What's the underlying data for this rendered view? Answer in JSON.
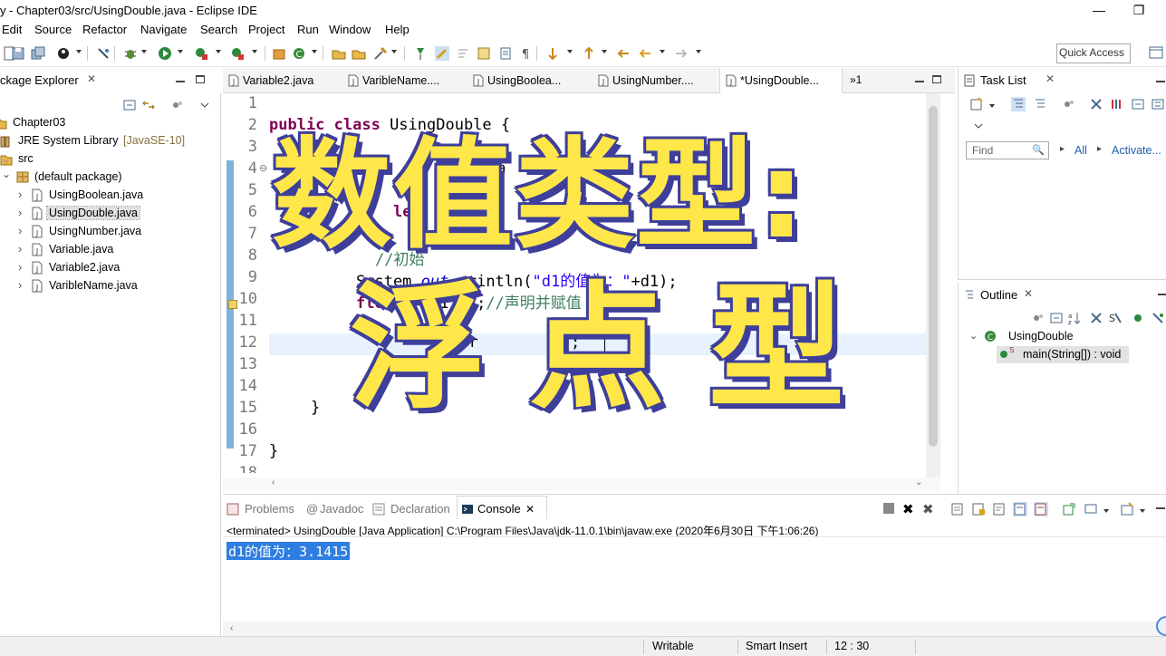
{
  "window": {
    "title": "y - Chapter03/src/UsingDouble.java - Eclipse IDE"
  },
  "menu": [
    "Edit",
    "Source",
    "Refactor",
    "Navigate",
    "Search",
    "Project",
    "Run",
    "Window",
    "Help"
  ],
  "toolbar": {
    "quick_access": "Quick Access"
  },
  "package_explorer": {
    "title": "ckage Explorer",
    "tree": [
      {
        "label": "Chapter03",
        "detail": "",
        "indent": 0,
        "arrow": "",
        "icon": "project-icon"
      },
      {
        "label": "JRE System Library",
        "detail": "[JavaSE-10]",
        "indent": 0,
        "arrow": "",
        "icon": "library-icon"
      },
      {
        "label": "src",
        "detail": "",
        "indent": 0,
        "arrow": "",
        "icon": "source-folder-icon"
      },
      {
        "label": "(default package)",
        "detail": "",
        "indent": 1,
        "arrow": "v",
        "icon": "package-icon"
      },
      {
        "label": "UsingBoolean.java",
        "detail": "",
        "indent": 2,
        "arrow": ">",
        "icon": "java-file-icon"
      },
      {
        "label": "UsingDouble.java",
        "detail": "",
        "indent": 2,
        "arrow": ">",
        "icon": "java-file-icon",
        "selected": true
      },
      {
        "label": "UsingNumber.java",
        "detail": "",
        "indent": 2,
        "arrow": ">",
        "icon": "java-file-icon"
      },
      {
        "label": "Variable.java",
        "detail": "",
        "indent": 2,
        "arrow": ">",
        "icon": "java-file-icon"
      },
      {
        "label": "Variable2.java",
        "detail": "",
        "indent": 2,
        "arrow": ">",
        "icon": "java-file-icon"
      },
      {
        "label": "VaribleName.java",
        "detail": "",
        "indent": 2,
        "arrow": ">",
        "icon": "java-file-icon"
      }
    ]
  },
  "editor": {
    "tabs": [
      "Variable2.java",
      "VaribleName....",
      "UsingBoolea...",
      "UsingNumber....",
      "*UsingDouble..."
    ],
    "overflow": "»1",
    "line_numbers": [
      "1",
      "2",
      "3",
      "4",
      "5",
      "6",
      "7",
      "8",
      "9",
      "10",
      "11",
      "12",
      "13",
      "14",
      "15",
      "16",
      "17",
      "18"
    ],
    "code": {
      "l2_kw": "public class",
      "l2_rest": " UsingDouble {",
      "l4": "ma",
      "l6": "le",
      "l7": "3",
      "l8": "//初始",
      "l9_a": "System.",
      "l9_out": "out",
      "l9_b": ".println(",
      "l9_str": "\"d1的值为：\"",
      "l9_c": "+d1);",
      "l10_kw": "float",
      "l10_rest": " f1=1.2f;",
      "l10_cmt": "//声明并赋值",
      "l12": ".pr          ;",
      "l15": "}",
      "l17": "}"
    }
  },
  "task_list": {
    "title": "Task List",
    "find_placeholder": "Find",
    "all_label": "All",
    "activate_label": "Activate..."
  },
  "outline": {
    "title": "Outline",
    "class_name": "UsingDouble",
    "method": "main(String[]) : void"
  },
  "console": {
    "tabs": [
      "Problems",
      "Javadoc",
      "Declaration",
      "Console"
    ],
    "terminated": "<terminated> UsingDouble [Java Application] C:\\Program Files\\Java\\jdk-11.0.1\\bin\\javaw.exe (2020年6月30日 下午1:06:26)",
    "output": "d1的值为：3.1415"
  },
  "status": {
    "writable": "Writable",
    "insert_mode": "Smart Insert",
    "position": "12 : 30"
  },
  "overlay": {
    "line1": "数值类型:",
    "line2": "浮点型"
  },
  "colors": {
    "keyword": "#7f0055",
    "string": "#2a00ff",
    "comment": "#3f7f5f",
    "overlay_fill": "#ffe74a",
    "overlay_stroke": "#3e3f9a",
    "console_selection": "#2e7de1"
  }
}
